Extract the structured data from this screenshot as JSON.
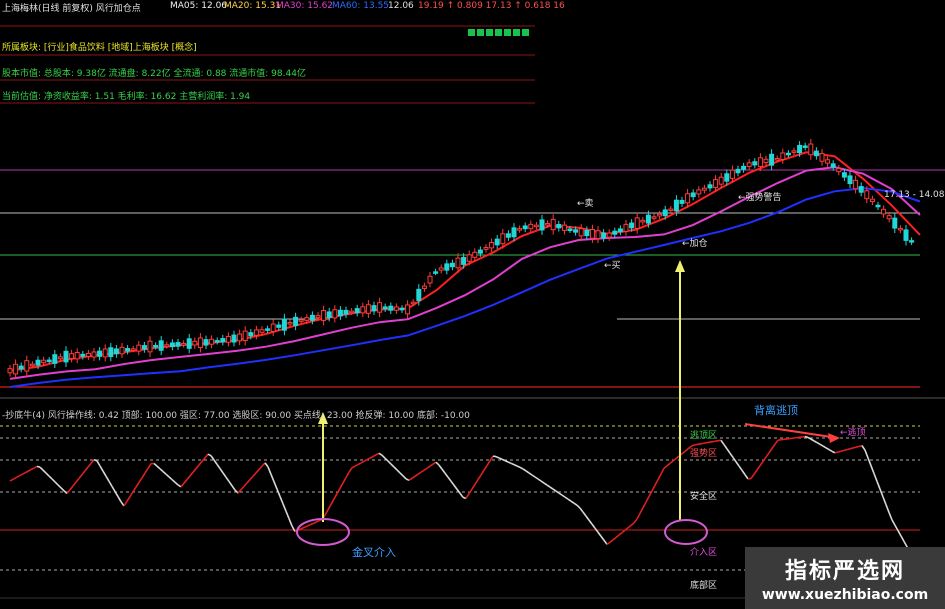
{
  "header": {
    "title": "上海梅林(日线 前复权) 风行加仓点",
    "ma5": "MA05: 12.06",
    "ma20": "MA20: 15.31",
    "ma30": "MA30: 15.62",
    "ma60": "MA60: 13.55",
    "ma120": "12.06",
    "price_tail": "19.19 ↑ 0.809  17.13 ↑ 0.618 16"
  },
  "info": {
    "sector": "所属板块: [行业]食品饮料 [地域]上海板块 [概念]",
    "capital": "股本市值: 总股本: 9.38亿  流通盘: 8.22亿  全流通: 0.88  流通市值: 98.44亿",
    "valuation": "当前估值: 净资收益率: 1.51  毛利率: 16.62  主营利润率: 1.94"
  },
  "indicator_header": "-抄底牛(4)   风行操作线: 0.42  顶部: 100.00  强区: 77.00  选股区: 90.00  买点线: 23.00  抢反弹: 10.00  底部: -10.00",
  "annotations": {
    "golden_cross": "金叉介入",
    "divergence_top": "背离逃顶",
    "escape_top": "逃顶区",
    "strong_zone": "强势区",
    "safe_zone": "安全区",
    "entry_zone": "介入区",
    "bottom_zone": "底部区",
    "sell": "←卖",
    "buy": "←买",
    "add": "←加仓",
    "trend_risk": "←强势警告",
    "escape": "←逃顶",
    "price_tag": "17.13 - 14.08"
  },
  "watermark": {
    "name": "指标严选网",
    "url": "www.xuezhibiao.com"
  },
  "colors": {
    "up": "#ff3b3b",
    "down": "#21d6d6",
    "ma_red": "#ff2020",
    "ma_magenta": "#e040d0",
    "ma_blue": "#2030ff",
    "ma_yellow": "#f0e060",
    "osc": "#d8d8d8"
  },
  "chart_data": {
    "type": "line",
    "title": "上海梅林(日线 前复权)",
    "x_index": [
      0,
      5,
      10,
      15,
      20,
      25,
      30,
      35,
      40,
      45,
      50,
      55,
      60,
      65,
      70,
      75,
      80,
      85,
      90,
      95,
      100,
      105,
      110,
      115,
      120,
      125,
      130,
      135,
      140,
      145,
      150,
      155,
      160
    ],
    "series": [
      {
        "name": "price_close",
        "values": [
          8.2,
          8.6,
          8.9,
          9.0,
          9.2,
          9.4,
          9.5,
          9.6,
          9.8,
          10.2,
          10.6,
          10.9,
          11.1,
          11.3,
          11.2,
          13.1,
          13.6,
          14.4,
          15.2,
          15.4,
          15.0,
          14.8,
          15.4,
          15.9,
          16.8,
          17.5,
          18.3,
          18.6,
          19.2,
          18.2,
          17.0,
          15.6,
          14.1
        ]
      },
      {
        "name": "indicator",
        "values": [
          60,
          72,
          50,
          78,
          40,
          75,
          55,
          82,
          50,
          75,
          20,
          30,
          70,
          82,
          60,
          75,
          45,
          80,
          70,
          55,
          40,
          10,
          28,
          70,
          88,
          92,
          60,
          92,
          95,
          82,
          88,
          30,
          -10
        ]
      }
    ],
    "levels": {
      "top": 100,
      "escape": 90,
      "strong": 77,
      "buy_line": 23,
      "rebound": 10,
      "bottom": -10
    }
  }
}
